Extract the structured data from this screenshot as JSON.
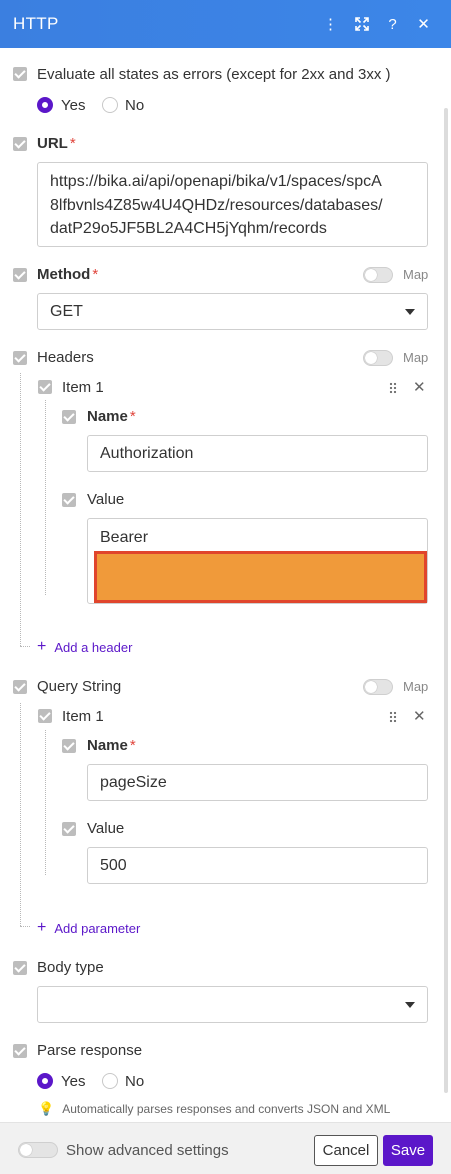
{
  "header": {
    "title": "HTTP"
  },
  "evaluate": {
    "label": "Evaluate all states as errors (except for 2xx and 3xx )",
    "yes": "Yes",
    "no": "No",
    "selected": "Yes"
  },
  "url": {
    "label": "URL",
    "required": "*",
    "lines": [
      "https://bika.ai/api/openapi/bika/v1/spaces/spcA",
      "8lfbvnls4Z85w4U4QHDz/resources/databases/",
      "datP29o5JF5BL2A4CH5jYqhm/records"
    ]
  },
  "method": {
    "label": "Method",
    "required": "*",
    "value": "GET",
    "map": "Map"
  },
  "headers": {
    "label": "Headers",
    "map": "Map",
    "item_label": "Item 1",
    "name_label": "Name",
    "name_required": "*",
    "name_value": "Authorization",
    "value_label": "Value",
    "value_value": "Bearer",
    "add_label": "Add a header"
  },
  "query": {
    "label": "Query String",
    "map": "Map",
    "item_label": "Item 1",
    "name_label": "Name",
    "name_required": "*",
    "name_value": "pageSize",
    "value_label": "Value",
    "value_value": "500",
    "add_label": "Add parameter"
  },
  "body_type": {
    "label": "Body type",
    "value": ""
  },
  "parse": {
    "label": "Parse response",
    "yes": "Yes",
    "no": "No",
    "selected": "Yes",
    "hint": "Automatically parses responses and converts JSON and XML"
  },
  "footer": {
    "advanced_label": "Show advanced settings",
    "cancel": "Cancel",
    "save": "Save"
  },
  "colors": {
    "header": "#3b7fe0",
    "accent": "#5b17c9",
    "redaction": "#f09a3a"
  }
}
